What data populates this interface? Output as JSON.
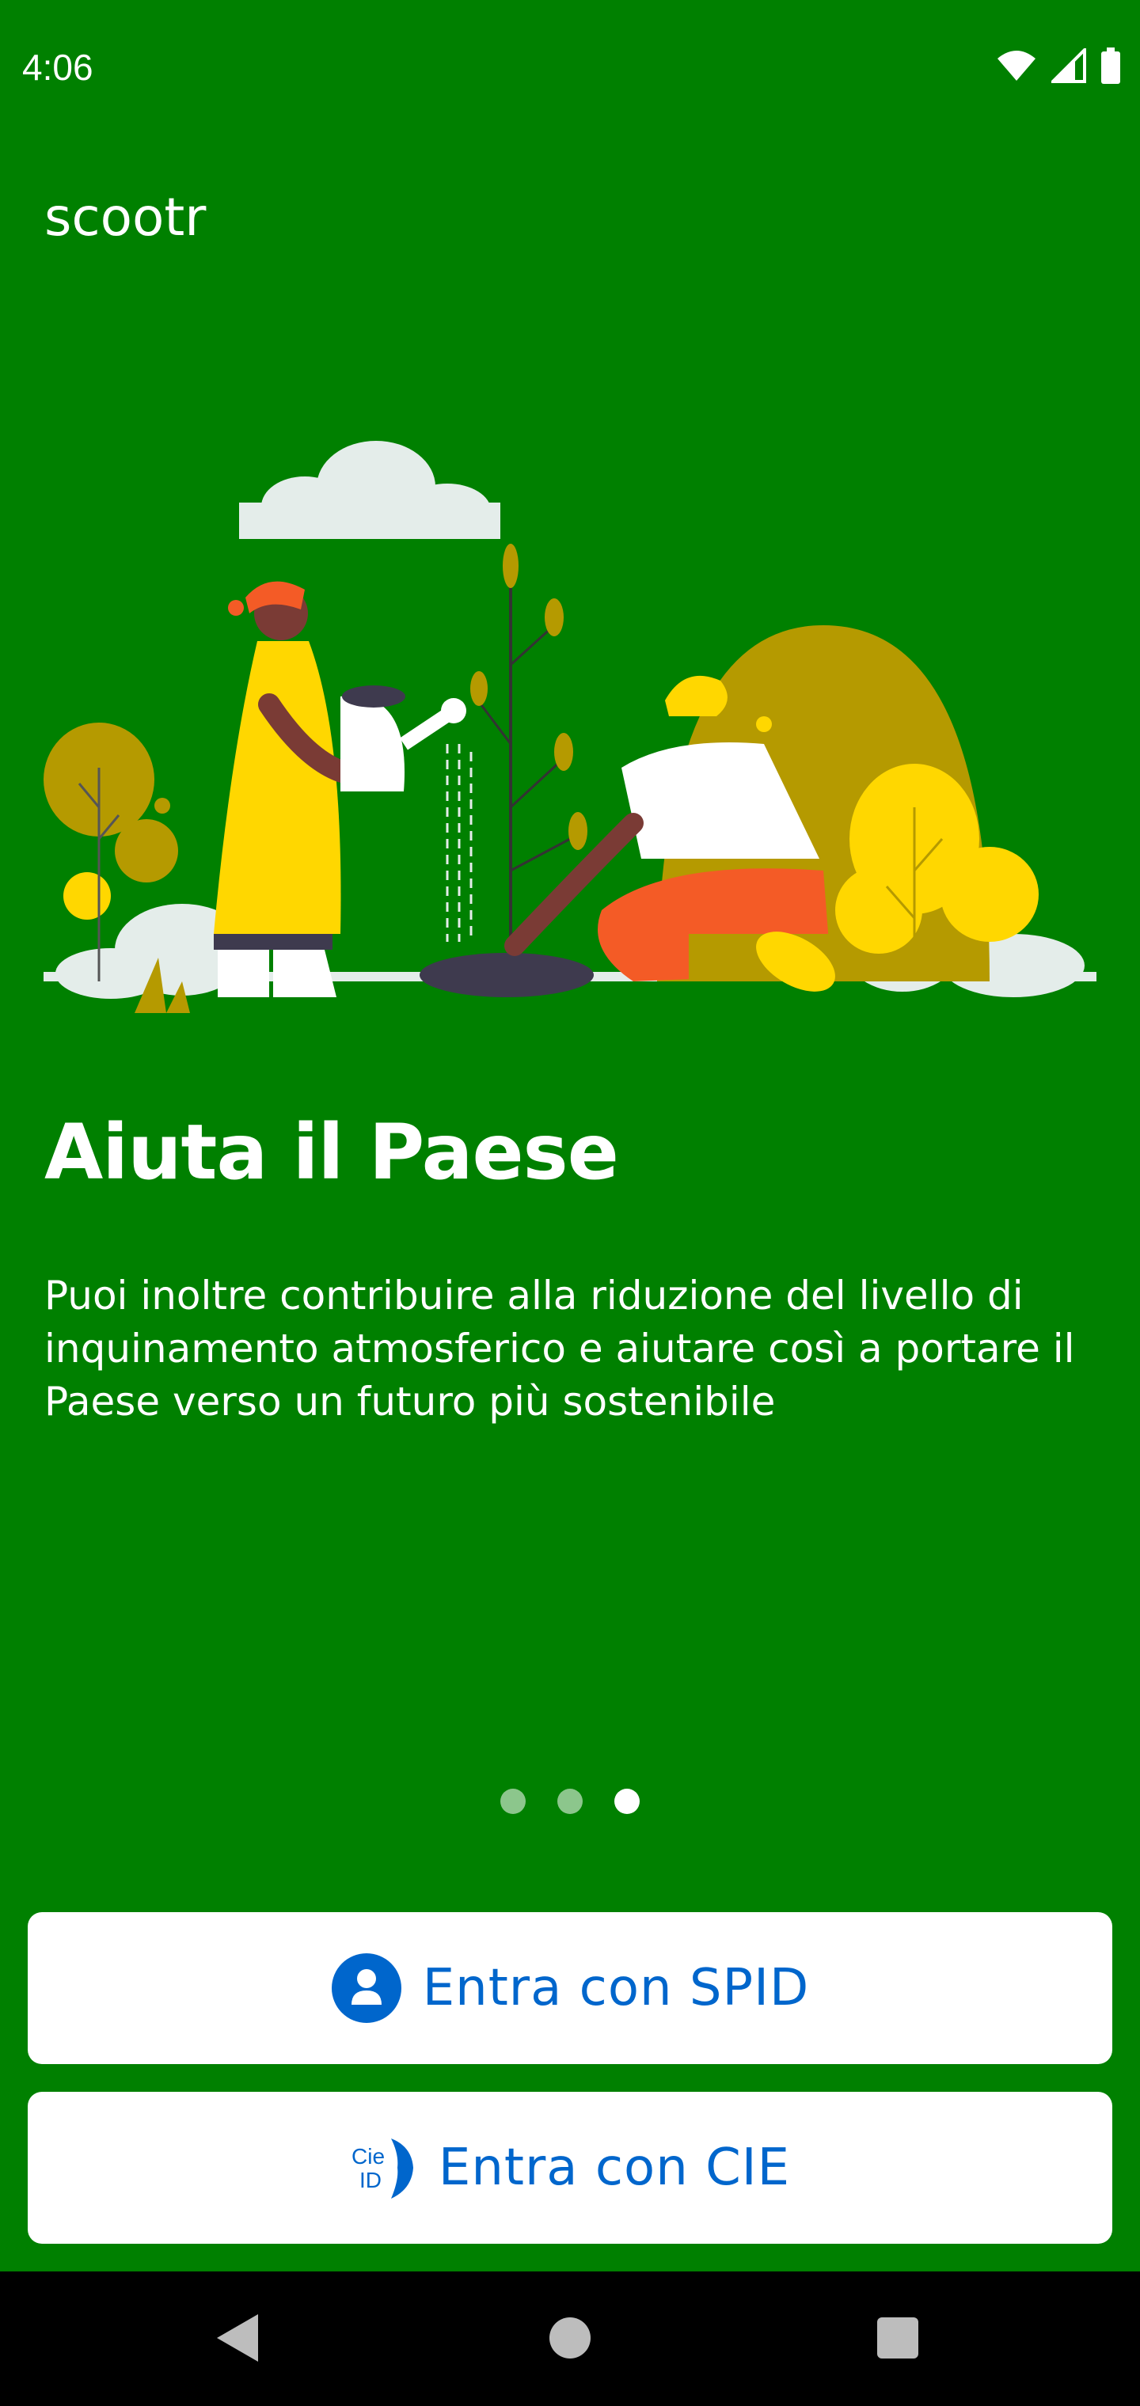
{
  "status_bar": {
    "time": "4:06",
    "icons": [
      "wifi-icon",
      "cellular-signal-icon",
      "battery-icon"
    ]
  },
  "app": {
    "name": "scootr"
  },
  "illustration": {
    "icon": "gardening-people-illustration",
    "colors": {
      "yellow": "#FFD700",
      "olive": "#B59A00",
      "orange": "#F45B26",
      "cloud": "#E4EDEA"
    }
  },
  "onboarding": {
    "title": "Aiuta il Paese",
    "description": "Puoi inoltre contribuire alla riduzione del livello di inquinamento atmosferico e aiutare così a portare il Paese verso un futuro più sostenibile",
    "page_index": 3,
    "page_count": 3
  },
  "buttons": {
    "spid_label": "Entra con SPID",
    "spid_icon": "user-circle-icon",
    "cie_label": "Entra con CIE",
    "cie_icon": "cie-id-logo",
    "cie_logo_text": [
      "Cie",
      "ID"
    ]
  },
  "nav_bar": {
    "icons": [
      "back-icon",
      "home-icon",
      "recents-icon"
    ]
  },
  "colors": {
    "background": "#008000",
    "button_text": "#0066CC",
    "button_bg": "#FFFFFF"
  }
}
